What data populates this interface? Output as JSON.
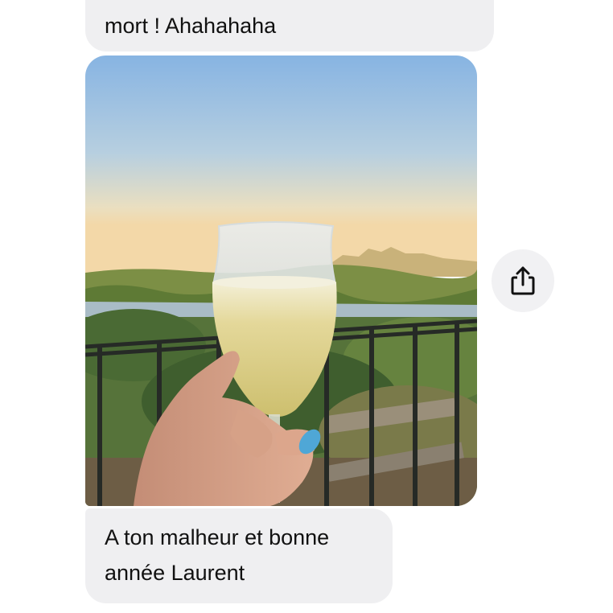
{
  "messages": {
    "top_line_partial": "mort ! Ahahahaha",
    "caption_line1": "A ton malheur et bonne",
    "caption_line2": "année Laurent"
  },
  "photo": {
    "subject": "hand holding a glass of white wine on a balcony at sunset"
  },
  "share": {
    "icon": "share-icon"
  },
  "colors": {
    "bubble": "#efeff1",
    "background": "#ffffff"
  }
}
